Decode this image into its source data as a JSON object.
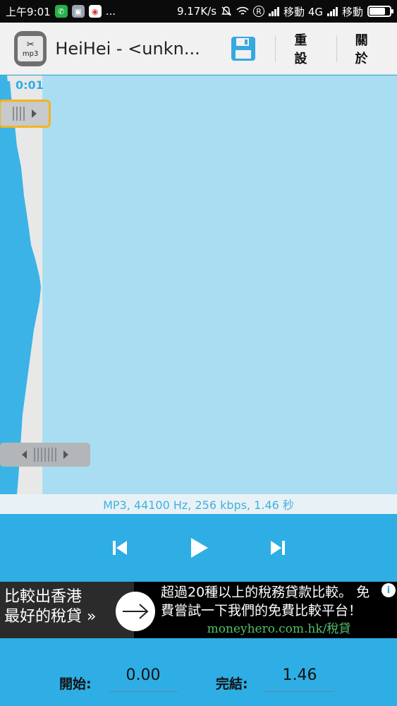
{
  "status_bar": {
    "time": "上午9:01",
    "more": "...",
    "speed": "9.17K/s",
    "r_badge": "R",
    "carrier1": "移動 4G",
    "carrier2": "移動"
  },
  "action_bar": {
    "app_icon_label": "mp3",
    "title": "HeiHei - <unkn...",
    "reset_label": "重設",
    "about_label": "關於"
  },
  "waveform": {
    "time_label": "0:01",
    "info": "MP3, 44100 Hz, 256 kbps, 1.46 秒"
  },
  "ad": {
    "left_line1": "比較出香港",
    "left_line2": "最好的稅貸 »",
    "right_line1": "超過20種以上的稅務貸款比較。 免",
    "right_line2": "費嘗試一下我們的免費比較平台！",
    "url": "moneyhero.com.hk/稅貸",
    "info": "i"
  },
  "range": {
    "start_label": "開始:",
    "start_value": "0.00",
    "end_label": "完結:",
    "end_value": "1.46"
  },
  "colors": {
    "accent": "#2eaee4",
    "wave_bg": "#a9def2",
    "handle_highlight": "#f4b41d",
    "ad_url": "#4fc16a"
  },
  "icons": [
    "whatsapp-icon",
    "app-notification-icon",
    "browser-icon",
    "mute-icon",
    "wifi-icon",
    "signal-icon",
    "battery-icon",
    "mp3-app-icon",
    "save-icon",
    "skip-back-icon",
    "play-icon",
    "skip-forward-icon",
    "arrow-right-icon",
    "info-icon"
  ]
}
